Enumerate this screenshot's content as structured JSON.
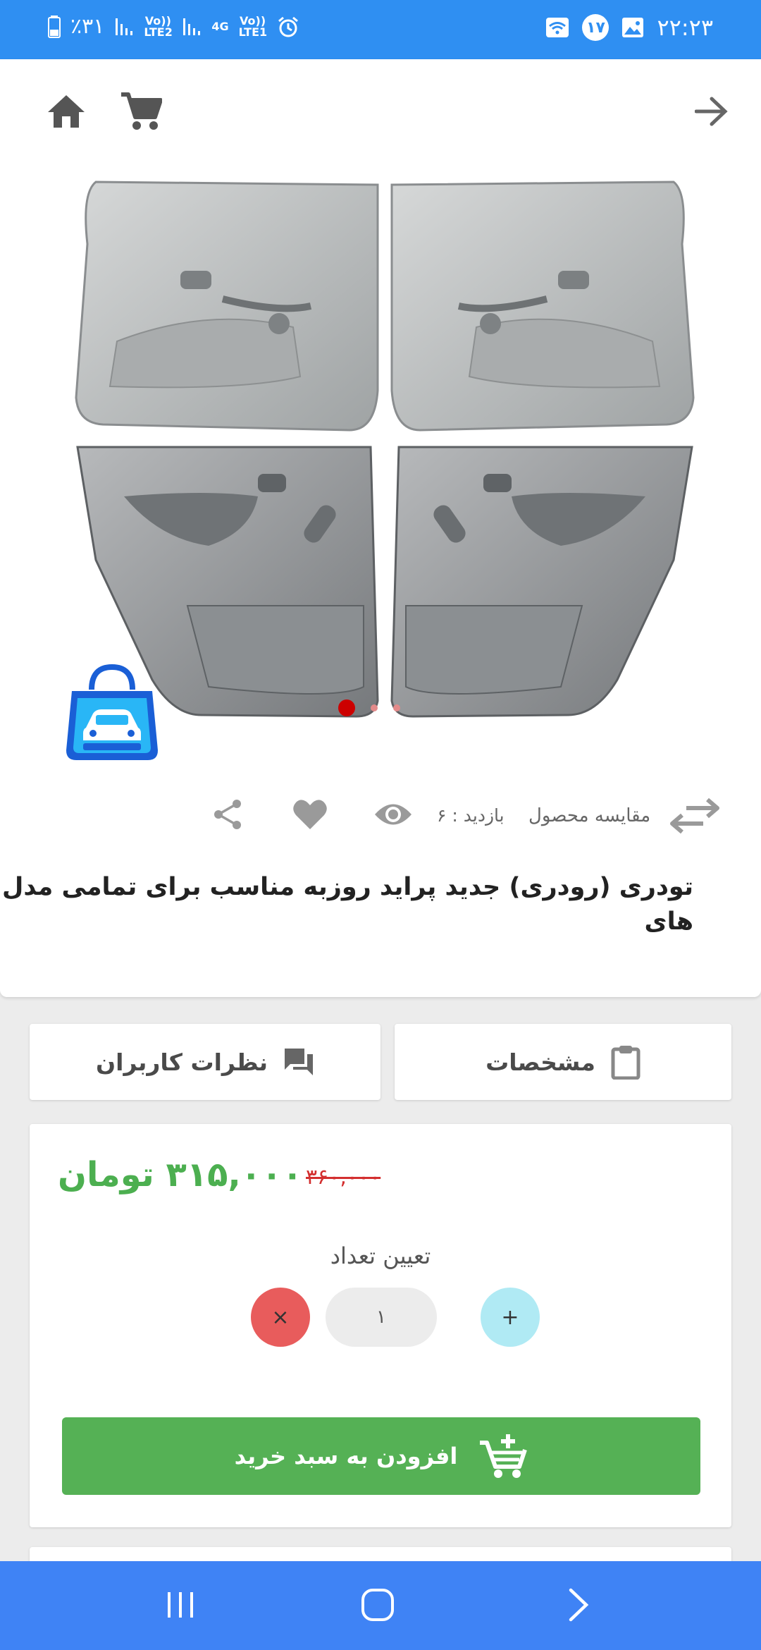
{
  "status_bar": {
    "battery": "٪۳۱",
    "sim1": "Vo)) LTE2",
    "network": "4G",
    "sim2": "Vo)) LTE1",
    "notification_count": "۱۷",
    "time": "۲۲:۲۳"
  },
  "product": {
    "title": "تودری (رودری) جدید پراید روزبه مناسب برای تمامی مدل های",
    "visits": "بازدید : ۶",
    "compare_label": "مقایسه محصول",
    "image_count": 3,
    "active_image": 1
  },
  "tabs": {
    "specs_label": "مشخصات",
    "comments_label": "نظرات کاربران"
  },
  "pricing": {
    "price": "۳۱۵,۰۰۰ تومان",
    "old_price": "۳۶۰,۰۰۰",
    "quantity_label": "تعیین تعداد",
    "quantity": "۱",
    "remove_symbol": "×",
    "add_symbol": "+",
    "add_to_cart_label": "افزودن به سبد خرید"
  },
  "colors": {
    "status_bar": "#2f8ff2",
    "nav_bar": "#3f83f5",
    "price_green": "#4caf50",
    "old_price_red": "#d32f2f",
    "add_button": "#55b155"
  },
  "icons": [
    "home-icon",
    "cart-icon",
    "arrow-forward-icon",
    "share-icon",
    "heart-icon",
    "eye-icon",
    "compare-icon",
    "clipboard-icon",
    "chat-icon",
    "add-cart-icon"
  ]
}
